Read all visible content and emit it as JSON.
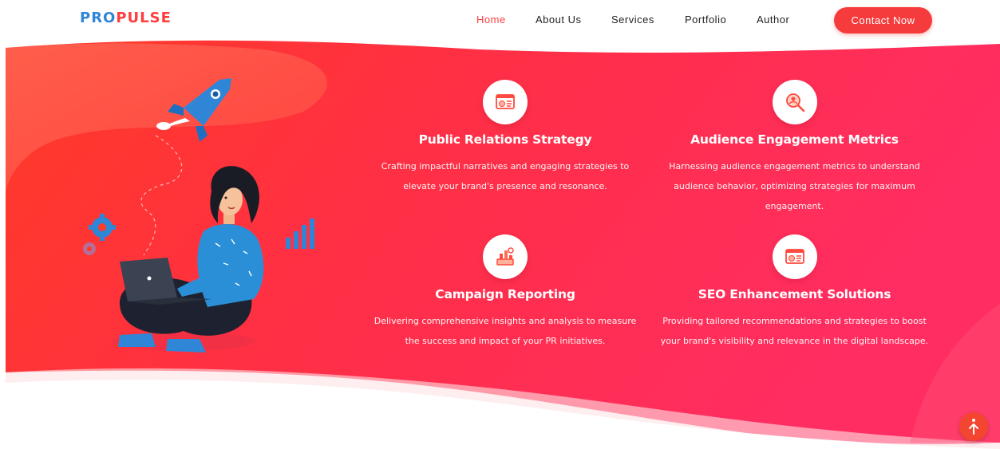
{
  "header": {
    "logo_part1": "PRO",
    "logo_part2": "PULSE",
    "nav": [
      {
        "label": "Home",
        "active": true
      },
      {
        "label": "About Us",
        "active": false
      },
      {
        "label": "Services",
        "active": false
      },
      {
        "label": "Portfolio",
        "active": false
      },
      {
        "label": "Author",
        "active": false
      }
    ],
    "cta_label": "Contact Now"
  },
  "services": [
    {
      "title": "Public Relations Strategy",
      "description": "Crafting impactful narratives and engaging strategies to elevate your brand's presence and resonance.",
      "icon": "pr-strategy-icon"
    },
    {
      "title": "Audience Engagement Metrics",
      "description": "Harnessing audience engagement metrics to understand audience behavior, optimizing strategies for maximum engagement.",
      "icon": "engagement-metrics-icon"
    },
    {
      "title": "Campaign Reporting",
      "description": "Delivering comprehensive insights and analysis to measure the success and impact of your PR initiatives.",
      "icon": "campaign-report-icon"
    },
    {
      "title": "SEO Enhancement Solutions",
      "description": "Providing tailored recommendations and strategies to boost your brand's visibility and relevance in the digital landscape.",
      "icon": "seo-icon"
    }
  ],
  "colors": {
    "accent": "#ff3d3d",
    "brand_blue": "#2f86d6",
    "hero_start": "#ff3a2c",
    "hero_end": "#ff2d5e"
  }
}
